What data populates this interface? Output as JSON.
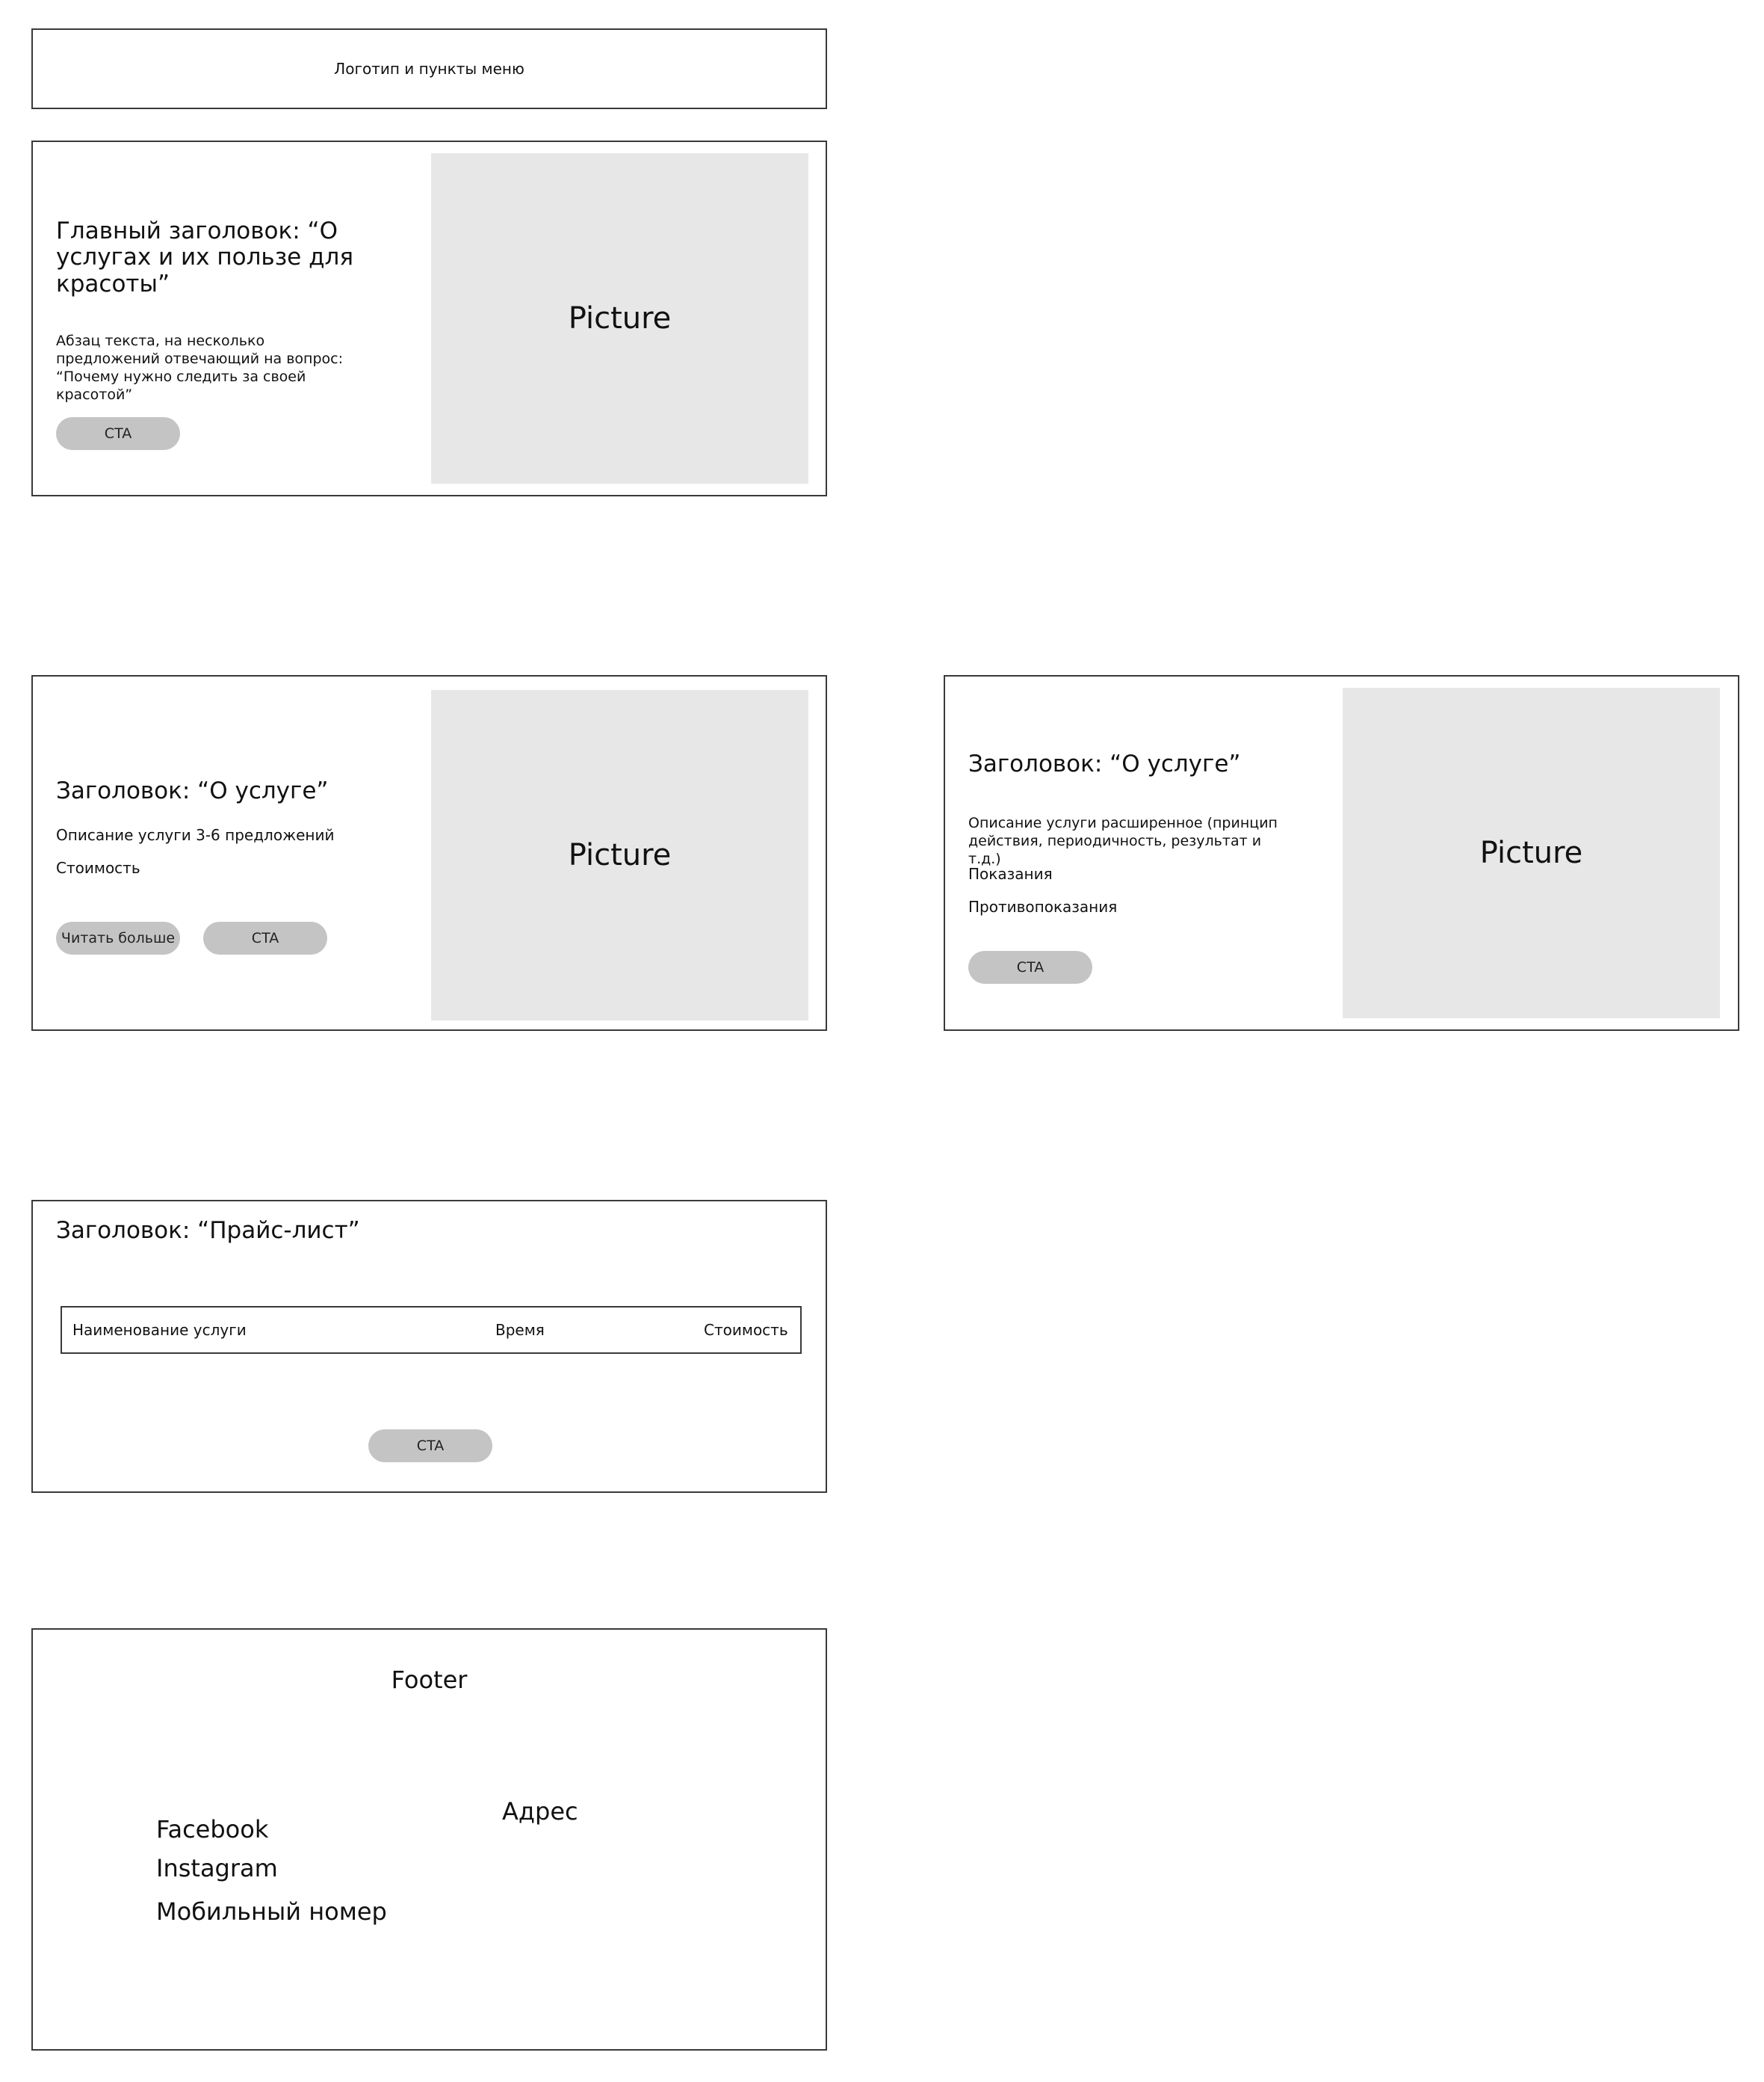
{
  "header": {
    "label": "Логотип и пункты меню"
  },
  "hero": {
    "title": "Главный заголовок: “О услугах и их пользе для красоты”",
    "paragraph": "Абзац текста, на несколько предложений отвечающий на вопрос: “Почему нужно следить за своей красотой”",
    "cta_label": "CTA",
    "picture_label": "Picture"
  },
  "service_short": {
    "title": "Заголовок: “О услуге”",
    "description": "Описание услуги 3-6 предложений",
    "price": "Стоимость",
    "read_more_label": "Читать больше",
    "cta_label": "CTA",
    "picture_label": "Picture"
  },
  "service_detail": {
    "title": "Заголовок: “О услуге”",
    "description": "Описание услуги расширенное (принцип действия, периодичность, результат и т.д.)",
    "indications": "Показания",
    "contraindications": "Противопоказания",
    "cta_label": "CTA",
    "picture_label": "Picture"
  },
  "pricelist": {
    "title": "Заголовок: “Прайс-лист”",
    "columns": [
      "Наименование услуги",
      "Время",
      "Стоимость"
    ],
    "cta_label": "CTA"
  },
  "footer": {
    "title": "Footer",
    "links": [
      "Facebook",
      "Instagram",
      "Мобильный номер"
    ],
    "address": "Адрес"
  }
}
